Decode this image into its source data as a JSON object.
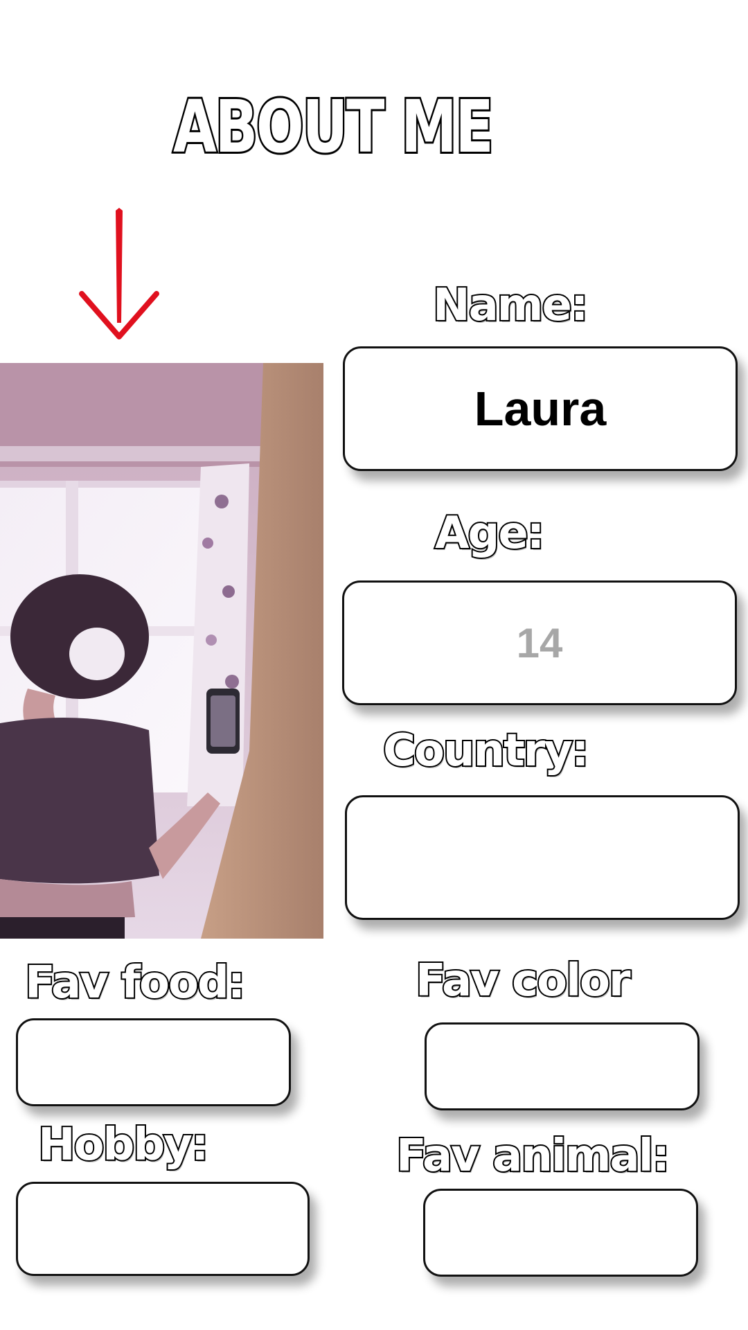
{
  "title": "ABOUT ME",
  "fields": {
    "name": {
      "label": "Name:",
      "value": "Laura"
    },
    "age": {
      "label": "Age:",
      "value": "14"
    },
    "country": {
      "label": "Country:",
      "value": ""
    },
    "fav_food": {
      "label": "Fav food:",
      "value": ""
    },
    "fav_color": {
      "label": "Fav color",
      "value": ""
    },
    "hobby": {
      "label": "Hobby:",
      "value": ""
    },
    "fav_animal": {
      "label": "Fav animal:",
      "value": ""
    }
  },
  "colors": {
    "arrow": "#e0101e",
    "age_value": "#a7a7a7",
    "photo_tint": "#b79ab8"
  },
  "icons": {
    "pointer": "red-down-arrow-icon"
  }
}
